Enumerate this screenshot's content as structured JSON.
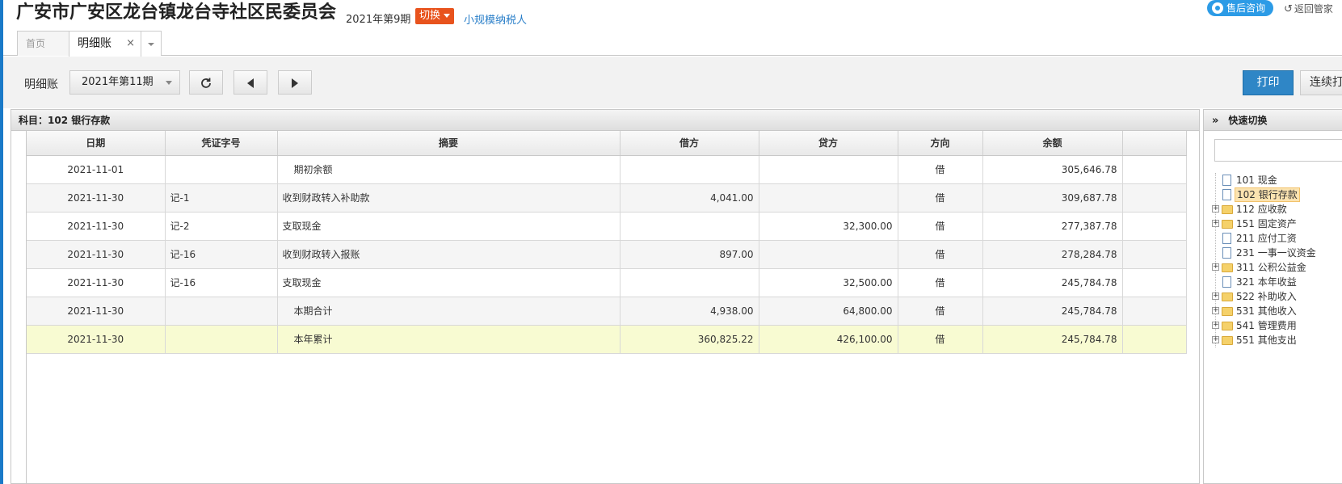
{
  "header": {
    "org_name": "广安市广安区龙台镇龙台寺社区民委员会",
    "period": "2021年第9期",
    "switch_label": "切换",
    "taxpayer_type": "小规模纳税人",
    "service_label": "售后咨询",
    "return_label": "返回管家"
  },
  "tabs": {
    "home": "首页",
    "detail": "明细账",
    "close_glyph": "×"
  },
  "toolbar": {
    "label": "明细账",
    "period_value": "2021年第11期",
    "print_label": "打印",
    "continuous_label": "连续打"
  },
  "ledger": {
    "subject": "科目：102 银行存款",
    "columns": [
      "日期",
      "凭证字号",
      "摘要",
      "借方",
      "贷方",
      "方向",
      "余额"
    ],
    "rows": [
      {
        "date": "2021-11-01",
        "voucher": "",
        "summary": "期初余额",
        "debit": "",
        "credit": "",
        "direction": "借",
        "balance": "305,646.78"
      },
      {
        "date": "2021-11-30",
        "voucher": "记-1",
        "summary": "收到财政转入补助款",
        "debit": "4,041.00",
        "credit": "",
        "direction": "借",
        "balance": "309,687.78"
      },
      {
        "date": "2021-11-30",
        "voucher": "记-2",
        "summary": "支取现金",
        "debit": "",
        "credit": "32,300.00",
        "direction": "借",
        "balance": "277,387.78"
      },
      {
        "date": "2021-11-30",
        "voucher": "记-16",
        "summary": "收到财政转入报账",
        "debit": "897.00",
        "credit": "",
        "direction": "借",
        "balance": "278,284.78"
      },
      {
        "date": "2021-11-30",
        "voucher": "记-16",
        "summary": "支取现金",
        "debit": "",
        "credit": "32,500.00",
        "direction": "借",
        "balance": "245,784.78"
      },
      {
        "date": "2021-11-30",
        "voucher": "",
        "summary": "本期合计",
        "debit": "4,938.00",
        "credit": "64,800.00",
        "direction": "借",
        "balance": "245,784.78"
      },
      {
        "date": "2021-11-30",
        "voucher": "",
        "summary": "本年累计",
        "debit": "360,825.22",
        "credit": "426,100.00",
        "direction": "借",
        "balance": "245,784.78"
      }
    ]
  },
  "quick_switch": {
    "title": "快速切换",
    "items": [
      {
        "label": "101 现金",
        "type": "doc",
        "expandable": false
      },
      {
        "label": "102 银行存款",
        "type": "doc",
        "expandable": false,
        "selected": true
      },
      {
        "label": "112 应收款",
        "type": "folder",
        "expandable": true
      },
      {
        "label": "151 固定资产",
        "type": "folder",
        "expandable": true
      },
      {
        "label": "211 应付工资",
        "type": "doc",
        "expandable": false
      },
      {
        "label": "231 一事一议资金",
        "type": "doc",
        "expandable": false
      },
      {
        "label": "311 公积公益金",
        "type": "folder",
        "expandable": true
      },
      {
        "label": "321 本年收益",
        "type": "doc",
        "expandable": false
      },
      {
        "label": "522 补助收入",
        "type": "folder",
        "expandable": true
      },
      {
        "label": "531 其他收入",
        "type": "folder",
        "expandable": true
      },
      {
        "label": "541 管理费用",
        "type": "folder",
        "expandable": true
      },
      {
        "label": "551 其他支出",
        "type": "folder",
        "expandable": true
      }
    ]
  },
  "colors": {
    "accent_blue": "#2f86c6",
    "switch_orange": "#e8531d",
    "service_blue": "#2c9be6",
    "highlight_row": "#f8fbd2"
  }
}
